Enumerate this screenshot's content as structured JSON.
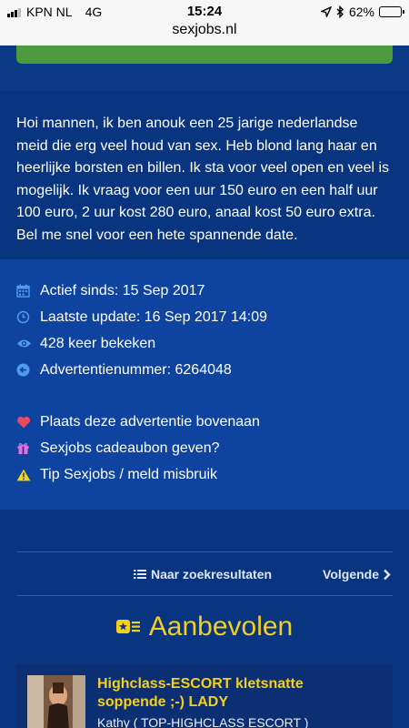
{
  "status_bar": {
    "carrier": "KPN NL",
    "network": "4G",
    "time": "15:24",
    "battery_percent": "62%",
    "battery_level": 0.62,
    "url": "sexjobs.nl"
  },
  "description": "Hoi mannen, ik ben anouk een 25 jarige nederlandse meid die erg veel houd van sex. Heb blond lang haar en heerlijke borsten en billen. Ik sta voor veel open en veel is mogelijk. Ik vraag voor een uur 150 euro en een half uur 100 euro, 2 uur kost 280 euro, anaal kost 50 euro extra. Bel me snel voor een hete spannende date.",
  "details": {
    "active_since": "Actief sinds: 15 Sep 2017",
    "last_update": "Laatste update: 16 Sep 2017 14:09",
    "views": "428 keer bekeken",
    "ad_number": "Advertentienummer: 6264048"
  },
  "actions": {
    "promote": "Plaats deze advertentie bovenaan",
    "gift": "Sexjobs cadeaubon geven?",
    "report": "Tip Sexjobs / meld misbruik"
  },
  "navigation": {
    "results": "Naar zoekresultaten",
    "next": "Volgende"
  },
  "recommended": {
    "heading": "Aanbevolen",
    "card": {
      "title": "Highclass-ESCORT kletsnatte soppende ;-) LADY",
      "subtitle": "Kathy ( TOP-HIGHCLASS ESCORT )"
    }
  },
  "colors": {
    "background": "#0b3a86",
    "info_background": "#0e44a0",
    "accent_yellow": "#f5cf1e",
    "green_button": "#4e9a3f",
    "icon_blue": "#4f9bf2",
    "heart_red": "#e84a5f",
    "gift_pink": "#e46fe0",
    "warning_yellow": "#f5d60e"
  },
  "icons": [
    "calendar-icon",
    "clock-icon",
    "eye-icon",
    "arrow-left-circle-icon",
    "heart-icon",
    "gift-icon",
    "warning-icon",
    "list-icon",
    "chevron-right-icon",
    "badge-list-icon"
  ]
}
